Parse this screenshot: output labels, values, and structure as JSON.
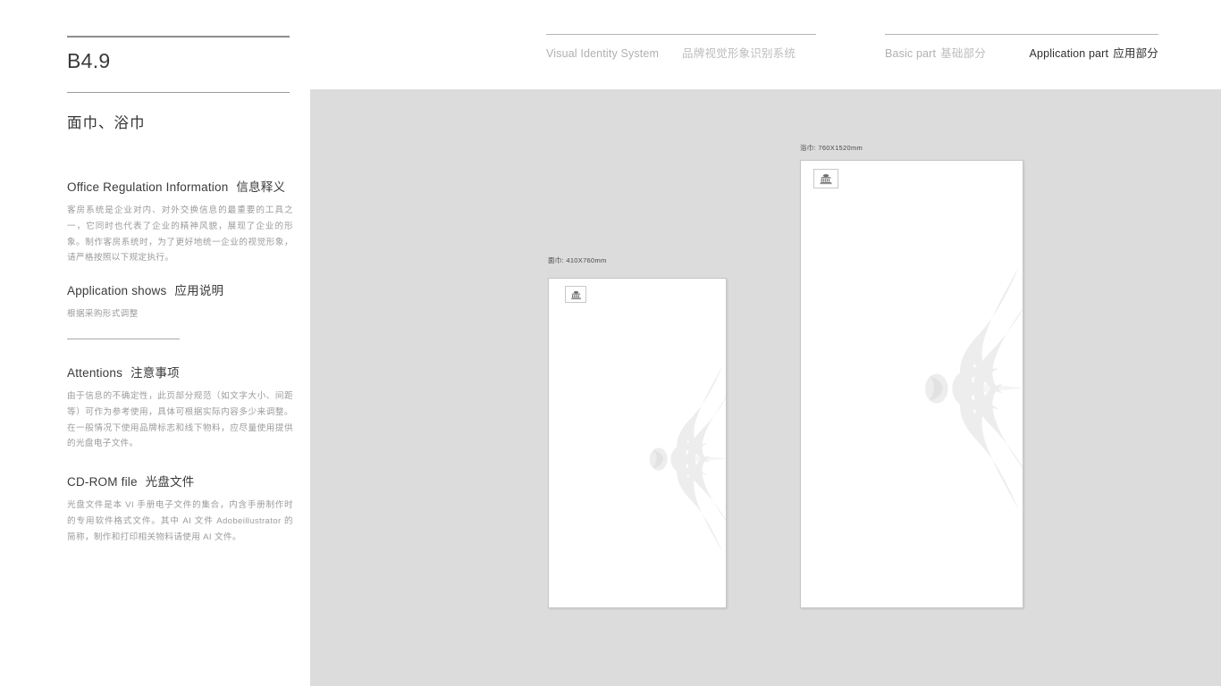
{
  "header": {
    "vis_en": "Visual Identity System",
    "vis_cn": "品牌视觉形象识别系统",
    "basic_en": "Basic part",
    "basic_cn": "基础部分",
    "app_en": "Application part",
    "app_cn": "应用部分"
  },
  "sidebar": {
    "code": "B4.9",
    "title": "面巾、浴巾",
    "sections": [
      {
        "heading_en": "Office Regulation Information",
        "heading_cn": "信息释义",
        "body": "客房系统是企业对内、对外交换信息的最重要的工具之一，它同时也代表了企业的精神风貌，展现了企业的形象。制作客房系统时，为了更好地统一企业的视觉形象，请严格按照以下规定执行。"
      },
      {
        "heading_en": "Application shows",
        "heading_cn": "应用说明",
        "body": "根据采购形式调整"
      },
      {
        "heading_en": "Attentions",
        "heading_cn": "注意事项",
        "body": "由于信息的不确定性，此页部分规范（如文字大小、间距等）可作为参考使用，具体可根据实际内容多少来调整。在一般情况下使用品牌标志和线下物料，应尽量使用提供的光盘电子文件。"
      },
      {
        "heading_en": "CD-ROM file",
        "heading_cn": "光盘文件",
        "body": "光盘文件是本 VI 手册电子文件的集合，内含手册制作时的专用软件格式文件。其中 AI 文件 Adobeillustrator 的简称，制作和打印相关物料请使用 AI 文件。"
      }
    ]
  },
  "mockups": [
    {
      "label": "面巾:  410X760mm",
      "name": "face-towel"
    },
    {
      "label": "浴巾:  760X1520mm",
      "name": "bath-towel"
    }
  ],
  "colors": {
    "canvas_bg": "#dcdcdc",
    "page_bg": "#ffffff",
    "rule": "#8e8e8e",
    "body_text": "#9b9b9b",
    "heading_text": "#3a3a3a",
    "muted_nav": "#b0b0b0",
    "active_nav": "#2e2e2e",
    "ornament": "#eeeeee"
  }
}
